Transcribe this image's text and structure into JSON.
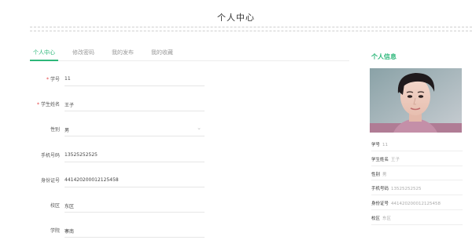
{
  "header": {
    "title": "个人中心"
  },
  "tabs": [
    {
      "label": "个人中心",
      "active": true
    },
    {
      "label": "修改密码",
      "active": false
    },
    {
      "label": "我的发布",
      "active": false
    },
    {
      "label": "我的收藏",
      "active": false
    }
  ],
  "form": {
    "fields": [
      {
        "label": "学号",
        "value": "11",
        "required": true
      },
      {
        "label": "学生姓名",
        "value": "王子",
        "required": true
      },
      {
        "label": "性别",
        "value": "男",
        "required": false,
        "type": "select"
      },
      {
        "label": "手机号码",
        "value": "13525252525",
        "required": false
      },
      {
        "label": "身份证号",
        "value": "441420200012125458",
        "required": false
      },
      {
        "label": "校区",
        "value": "东区",
        "required": false
      },
      {
        "label": "学院",
        "value": "寨南",
        "required": false
      }
    ],
    "required_mark": "*",
    "select_chevron_icon": "chevron-down-icon"
  },
  "sidebar": {
    "title": "个人信息",
    "avatar_alt": "avatar photo",
    "info": [
      {
        "label": "学号",
        "value": "11"
      },
      {
        "label": "学生姓名",
        "value": "王子"
      },
      {
        "label": "性别",
        "value": "男"
      },
      {
        "label": "手机号码",
        "value": "13525252525"
      },
      {
        "label": "身份证号",
        "value": "441420200012125458"
      },
      {
        "label": "校区",
        "value": "东区"
      }
    ]
  },
  "colors": {
    "accent": "#2db77a",
    "required": "#e4393c"
  }
}
